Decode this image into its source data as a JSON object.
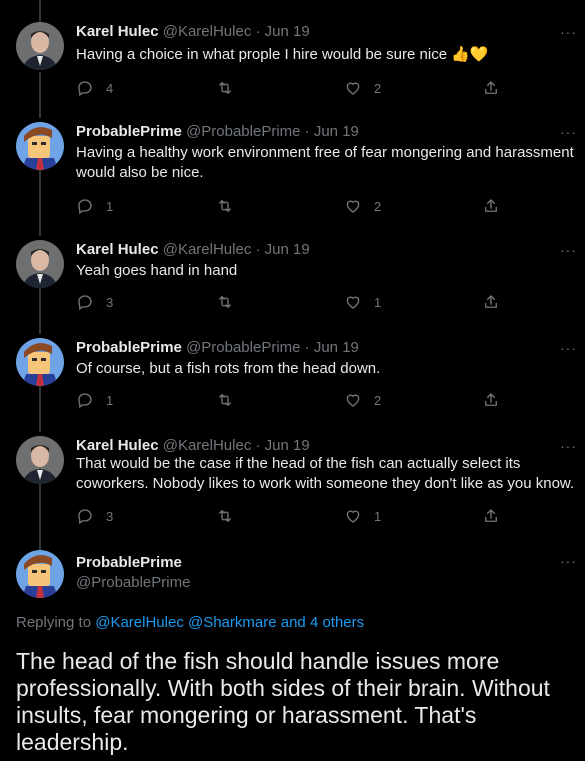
{
  "tweets": [
    {
      "name": "Karel Hulec",
      "handle": "@KarelHulec",
      "date": "Jun 19",
      "text": "Having a choice in what prople I hire would be sure nice 👍💛",
      "replies": "4",
      "retweets": "",
      "likes": "2"
    },
    {
      "name": "ProbablePrime",
      "handle": "@ProbablePrime",
      "date": "Jun 19",
      "text": "Having a healthy work environment free of fear mongering and harassment would also be nice.",
      "replies": "1",
      "retweets": "",
      "likes": "2"
    },
    {
      "name": "Karel Hulec",
      "handle": "@KarelHulec",
      "date": "Jun 19",
      "text": "Yeah goes hand in hand",
      "replies": "3",
      "retweets": "",
      "likes": "1"
    },
    {
      "name": "ProbablePrime",
      "handle": "@ProbablePrime",
      "date": "Jun 19",
      "text": "Of course, but a fish rots from the head down.",
      "replies": "1",
      "retweets": "",
      "likes": "2"
    },
    {
      "name": "Karel Hulec",
      "handle": "@KarelHulec",
      "date": "Jun 19",
      "text": "That would be the case if the head of the fish can actually select its coworkers. Nobody likes to work with someone they don't like as you know.",
      "replies": "3",
      "retweets": "",
      "likes": "1"
    }
  ],
  "separator": "·",
  "more_glyph": "···",
  "main": {
    "name": "ProbablePrime",
    "handle": "@ProbablePrime",
    "replying_prefix": "Replying to",
    "replying_to_1": "@KarelHulec",
    "replying_to_2": "@Sharkmare",
    "replying_suffix": "and 4 others",
    "text": "The head of the fish should handle issues more professionally. With both sides of their brain. Without insults, fear mongering or harassment. That's leadership."
  },
  "icons": {
    "reply": "reply-icon",
    "retweet": "retweet-icon",
    "like": "heart-icon",
    "share": "share-icon",
    "more": "more-icon"
  },
  "colors": {
    "background": "#000000",
    "text": "#e7e9ea",
    "muted": "#71767b",
    "link": "#1d9bf0",
    "thread_line": "#333639"
  }
}
